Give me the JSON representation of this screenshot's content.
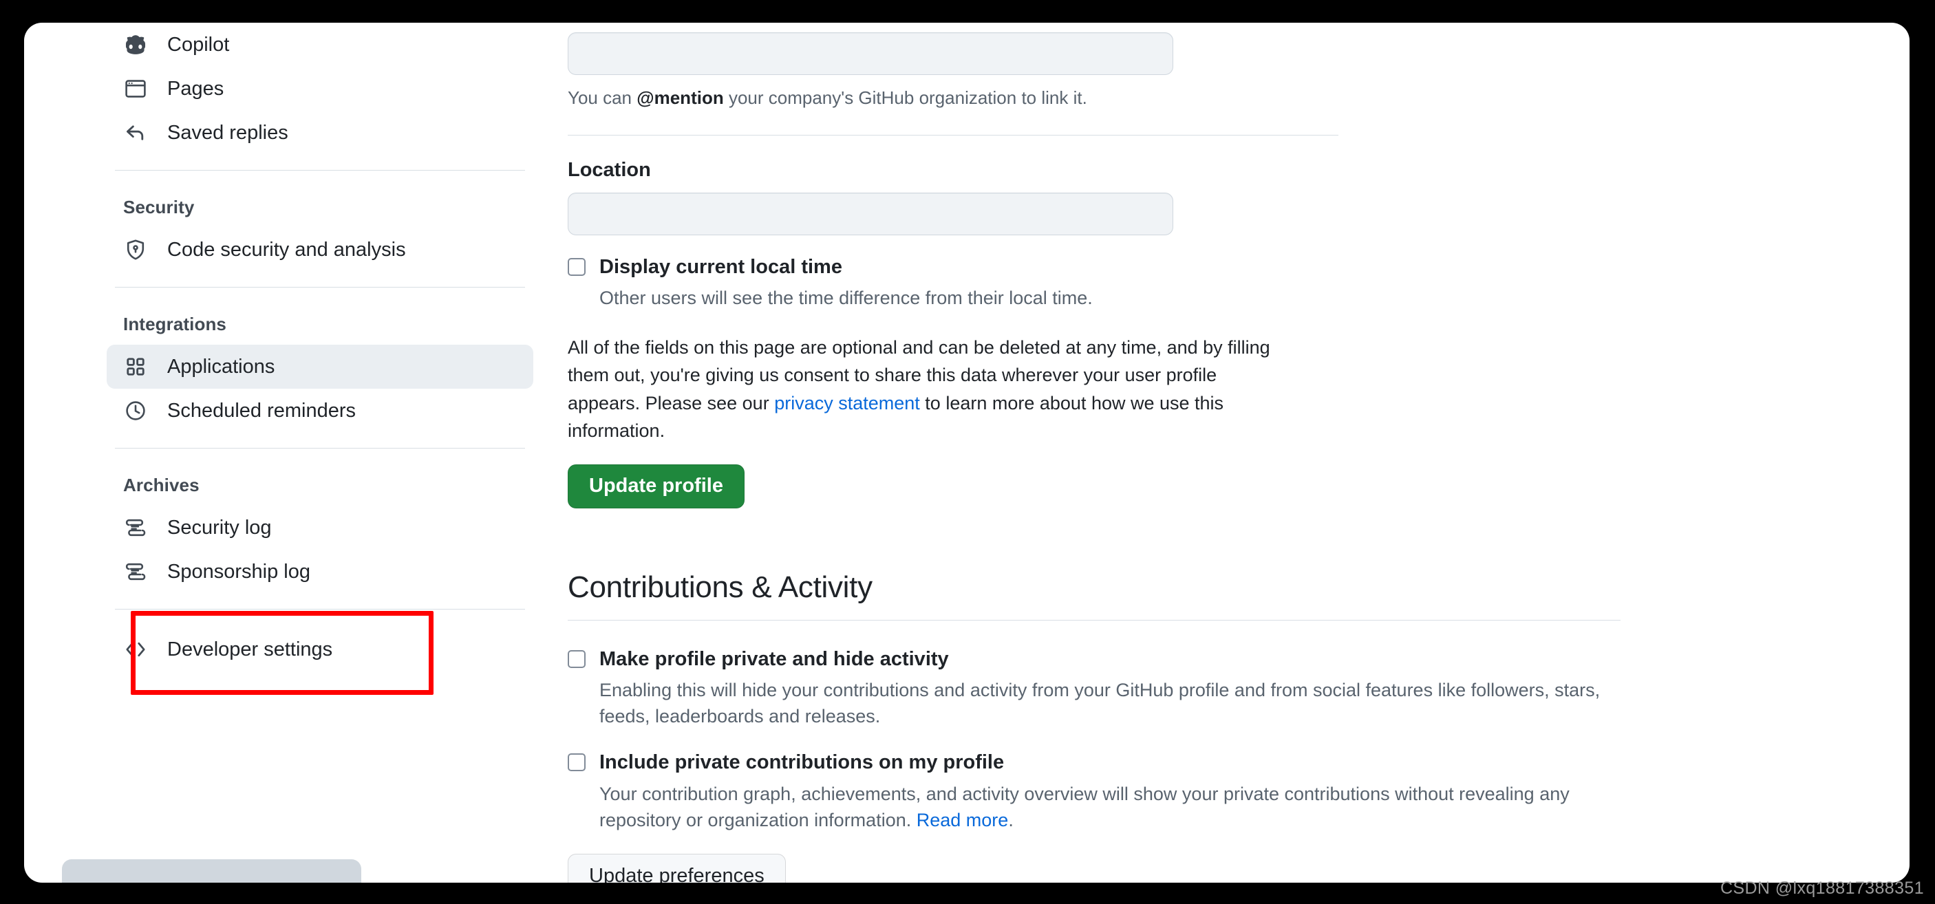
{
  "sidebar": {
    "top_items": [
      {
        "label": "Copilot",
        "icon": "copilot-icon",
        "selected": false
      },
      {
        "label": "Pages",
        "icon": "browser-window-icon",
        "selected": false
      },
      {
        "label": "Saved replies",
        "icon": "reply-arrow-icon",
        "selected": false
      }
    ],
    "groups": [
      {
        "heading": "Security",
        "items": [
          {
            "label": "Code security and analysis",
            "icon": "shield-lock-icon",
            "selected": false
          }
        ]
      },
      {
        "heading": "Integrations",
        "items": [
          {
            "label": "Applications",
            "icon": "apps-grid-icon",
            "selected": true
          },
          {
            "label": "Scheduled reminders",
            "icon": "clock-icon",
            "selected": false
          }
        ]
      },
      {
        "heading": "Archives",
        "items": [
          {
            "label": "Security log",
            "icon": "scroll-log-icon",
            "selected": false
          },
          {
            "label": "Sponsorship log",
            "icon": "scroll-log-icon",
            "selected": false
          }
        ]
      }
    ],
    "developer_settings": {
      "label": "Developer settings",
      "icon": "code-brackets-icon",
      "selected": false
    },
    "highlight_color": "#ff0000"
  },
  "main": {
    "company_field": {
      "value": "",
      "hint_before": "You can ",
      "hint_bold": "@mention",
      "hint_after": " your company's GitHub organization to link it."
    },
    "location_field": {
      "label": "Location",
      "value": ""
    },
    "local_time_checkbox": {
      "title": "Display current local time",
      "description": "Other users will see the time difference from their local time.",
      "checked": false
    },
    "optional_notice": {
      "line": "All of the fields on this page are optional and can be deleted at any time, and by filling them out, you're giving us consent to share this data wherever your user profile appears. Please see our ",
      "link_text": "privacy statement",
      "line_end": " to learn more about how we use this information."
    },
    "update_profile_button": "Update profile",
    "contributions_section": {
      "title": "Contributions & Activity",
      "checkboxes": [
        {
          "title": "Make profile private and hide activity",
          "description": "Enabling this will hide your contributions and activity from your GitHub profile and from social features like followers, stars, feeds, leaderboards and releases.",
          "checked": false
        },
        {
          "title": "Include private contributions on my profile",
          "description": "Your contribution graph, achievements, and activity overview will show your private contributions without revealing any repository or organization information. ",
          "link_text": "Read more",
          "description_end": ".",
          "checked": false
        }
      ],
      "update_preferences_button": "Update preferences"
    }
  },
  "watermark": "CSDN @lxq18817388351",
  "colors": {
    "accent_link": "#0969da",
    "primary_button": "#1f883d",
    "selected_nav_bg": "#eaeef2",
    "annotation_red": "#ff0000",
    "page_background": "#ffffff",
    "frame_background": "#000000"
  }
}
